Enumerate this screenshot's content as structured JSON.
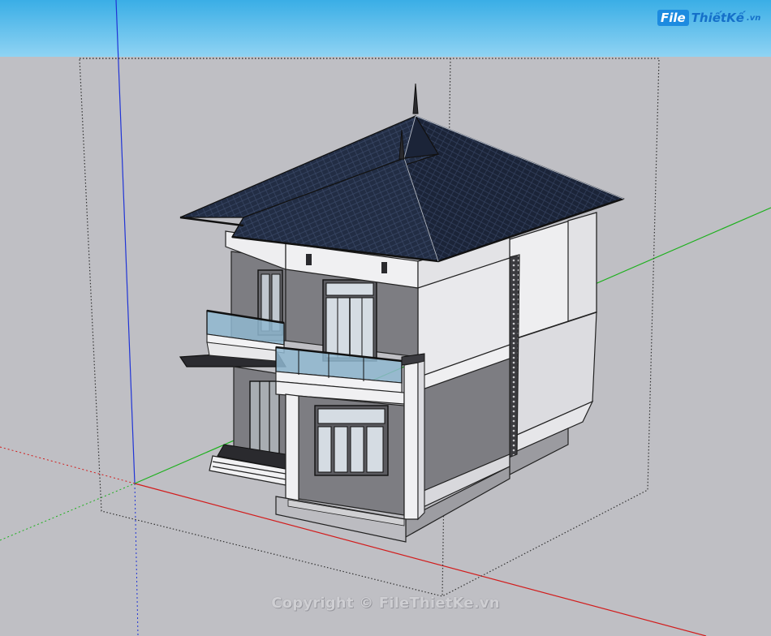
{
  "watermark": {
    "logo_box": "File",
    "logo_text": "ThiếtKế",
    "logo_suffix": ".vn",
    "copyright": "Copyright © FileThietKe.vn"
  },
  "colors": {
    "sky": "#43b2e8",
    "ground": "#bfbfc4",
    "roof": "#1f2a3f",
    "wall_light": "#e8e8ea",
    "wall_dark": "#7d7d82",
    "glass": "#8fb7d0",
    "axis_red": "#d21c1c",
    "axis_green": "#1db01d",
    "axis_blue": "#2034d6"
  },
  "icons": [
    "house-model",
    "bounding-box",
    "axis-lines"
  ]
}
